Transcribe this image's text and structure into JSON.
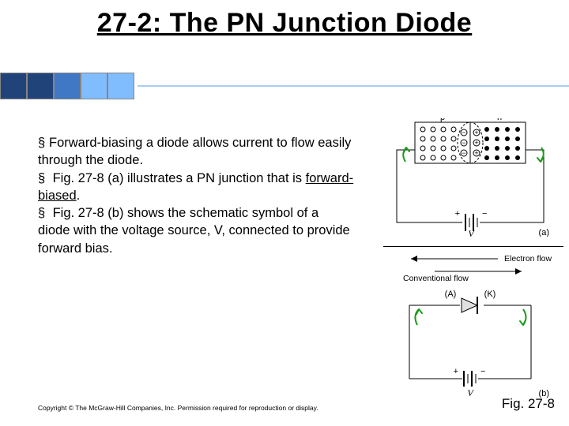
{
  "title": "27-2: The PN Junction Diode",
  "bullets": {
    "b1_pre": "Forward-biasing a diode allows current to flow easily through the diode.",
    "b2_pre": " Fig. 27-8 (a) illustrates a PN junction that is ",
    "b2_ul": "forward-biased",
    "b2_post": ".",
    "b3_pre": " Fig. 27-8 (b) shows the schematic symbol of a diode with the voltage source, V, connected to provide forward bias."
  },
  "diagram": {
    "p_label": "p",
    "n_label": "n",
    "voltage_label": "V",
    "sub_a": "(a)",
    "sub_b": "(b)",
    "electron_flow": "Electron flow",
    "conventional_flow": "Conventional flow",
    "anode": "(A)",
    "cathode": "(K)"
  },
  "figure_caption": "Fig. 27-8",
  "copyright": "Copyright © The McGraw-Hill Companies, Inc. Permission required for reproduction or display."
}
